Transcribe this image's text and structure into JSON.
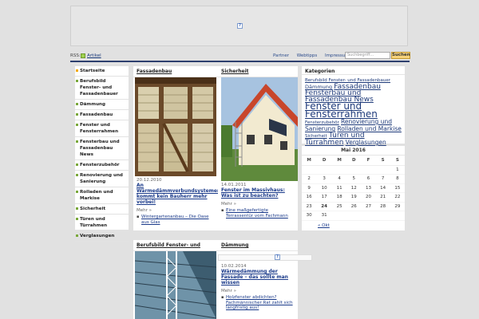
{
  "banner": {
    "placeholder_icon": "?"
  },
  "rss": {
    "label": "RSS:",
    "icon": "rss-icon",
    "link": "Artikel"
  },
  "toplinks": [
    "Partner",
    "Webtipps",
    "Impressum"
  ],
  "search": {
    "placeholder": "Suchbegriff...",
    "button": "Suchen"
  },
  "sidebar": {
    "items": [
      "Startseite",
      "Berufsbild Fenster- und Fassadenbauer",
      "Dämmung",
      "Fassadenbau",
      "Fenster und Fensterrahmen",
      "Fensterbau und Fassadenbau News",
      "Fensterzubehör",
      "Renovierung und Sanierung",
      "Rolladen und Markise",
      "Sicherheit",
      "Türen und Türrahmen",
      "Verglasungen"
    ]
  },
  "cards": {
    "fassadenbau": {
      "title": "Fassadenbau",
      "date": "20.12.2010",
      "headline": "An Wärmedämmverbundsystemen kommt kein Bauherr mehr vorbei!",
      "more": "Mehr »",
      "link": "Wintergartenanbau – Die Oase aus Glas"
    },
    "sicherheit": {
      "title": "Sicherheit",
      "date": "14.01.2011",
      "headline": "Fenster im Massivhaus: Was ist zu beachten?",
      "more": "Mehr »",
      "link": "Eine maßgefertigte Terrassentür vom Fachmann"
    },
    "berufsbild": {
      "title": "Berufsbild Fenster- und"
    },
    "daemmung": {
      "title": "Dämmung",
      "date": "10.02.2014",
      "headline": "Wärmedämmung der Fassade – das sollte man wissen",
      "more": "Mehr »",
      "link": "Holzfenster abdichten? Fachmännischer Rat zahlt sich langfristig aus!"
    }
  },
  "categories": {
    "title": "Kategorien",
    "tags": [
      {
        "text": "Berufsbild Fenster- und Fassadenbauer",
        "size": 5.5
      },
      {
        "text": "Dämmung",
        "size": 6.5
      },
      {
        "text": "Fassadenbau",
        "size": 9
      },
      {
        "text": "Fensterbau und Fassadenbau News",
        "size": 9
      },
      {
        "text": "Fenster und Fensterrahmen",
        "size": 12
      },
      {
        "text": "Fensterzubehör",
        "size": 5.5
      },
      {
        "text": "Renovierung und Sanierung",
        "size": 7.5
      },
      {
        "text": "Rolladen und Markise",
        "size": 7.5
      },
      {
        "text": "Sicherheit",
        "size": 5.5
      },
      {
        "text": "Türen und Türrahmen",
        "size": 9
      },
      {
        "text": "Verglasungen",
        "size": 7.5
      }
    ]
  },
  "calendar": {
    "caption": "Mai 2016",
    "weekdays": [
      "M",
      "D",
      "M",
      "D",
      "F",
      "S",
      "S"
    ],
    "weeks": [
      [
        "",
        "",
        "",
        "",
        "",
        "",
        "1"
      ],
      [
        "2",
        "3",
        "4",
        "5",
        "6",
        "7",
        "8"
      ],
      [
        "9",
        "10",
        "11",
        "12",
        "13",
        "14",
        "15"
      ],
      [
        "16",
        "17",
        "18",
        "19",
        "20",
        "21",
        "22"
      ],
      [
        "23",
        "24",
        "25",
        "26",
        "27",
        "28",
        "29"
      ],
      [
        "30",
        "31",
        "",
        "",
        "",
        "",
        ""
      ]
    ],
    "today": "24",
    "prev": "« Okt"
  }
}
